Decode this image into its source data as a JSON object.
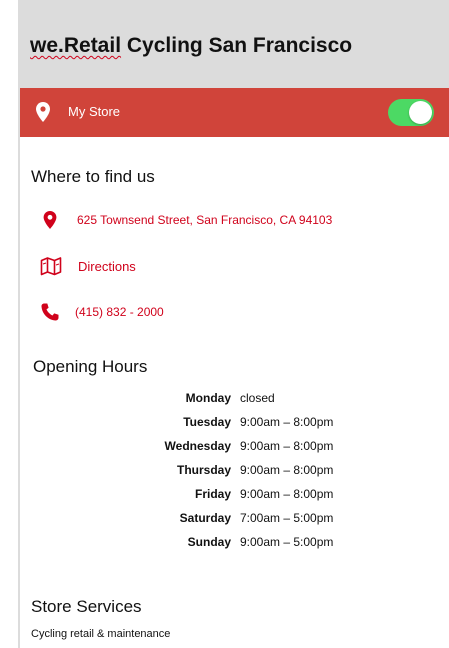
{
  "header": {
    "title_brand": "we.Retail",
    "title_rest": " Cycling San Francisco"
  },
  "store_bar": {
    "label": "My Store",
    "toggle_on": true,
    "color": "#d0443a",
    "toggle_color": "#4cd964"
  },
  "find_us": {
    "title": "Where to find us",
    "address": "625 Townsend Street, San Francisco, CA 94103",
    "directions_label": "Directions",
    "phone": "(415) 832 - 2000",
    "icons": [
      "map-pin-icon",
      "map-icon",
      "phone-icon"
    ],
    "accent_color": "#d0021b"
  },
  "opening_hours": {
    "title": "Opening Hours",
    "rows": [
      {
        "day": "Monday",
        "time": "closed"
      },
      {
        "day": "Tuesday",
        "time": "9:00am – 8:00pm"
      },
      {
        "day": "Wednesday",
        "time": "9:00am – 8:00pm"
      },
      {
        "day": "Thursday",
        "time": "9:00am – 8:00pm"
      },
      {
        "day": "Friday",
        "time": "9:00am – 8:00pm"
      },
      {
        "day": "Saturday",
        "time": "7:00am – 5:00pm"
      },
      {
        "day": "Sunday",
        "time": "9:00am – 5:00pm"
      }
    ]
  },
  "services": {
    "title": "Store Services",
    "text": "Cycling retail & maintenance"
  }
}
